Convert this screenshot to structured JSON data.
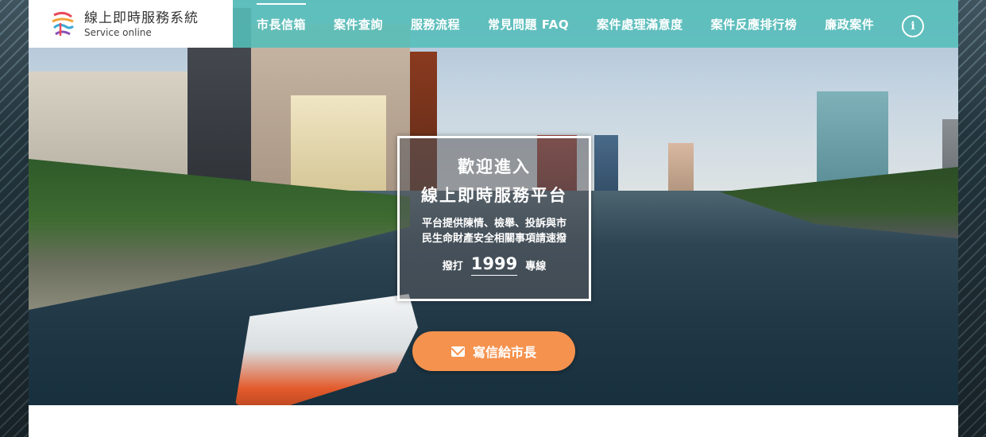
{
  "brand": {
    "title": "線上即時服務系統",
    "subtitle": "Service online",
    "logo_icon": "kaohsiung-logo-icon"
  },
  "nav": {
    "items": [
      {
        "label": "市長信箱",
        "active": true
      },
      {
        "label": "案件查詢",
        "active": false
      },
      {
        "label": "服務流程",
        "active": false
      },
      {
        "label": "常見問題 FAQ",
        "active": false
      },
      {
        "label": "案件處理滿意度",
        "active": false
      },
      {
        "label": "案件反應排行榜",
        "active": false
      },
      {
        "label": "廉政案件",
        "active": false
      }
    ],
    "info_label": "i"
  },
  "welcome": {
    "line1": "歡迎進入",
    "line2": "線上即時服務平台",
    "desc_line1": "平台提供陳情、檢舉、投訴與市",
    "desc_line2": "民生命財產安全相關事項請速撥",
    "hotline_prefix": "撥打",
    "hotline_number": "1999",
    "hotline_suffix": "專線"
  },
  "cta": {
    "label": "寫信給市長",
    "icon": "envelope-icon"
  },
  "colors": {
    "nav_bg": "#54beba",
    "cta_bg": "#f5924e",
    "brand_bg": "#ffffff"
  }
}
